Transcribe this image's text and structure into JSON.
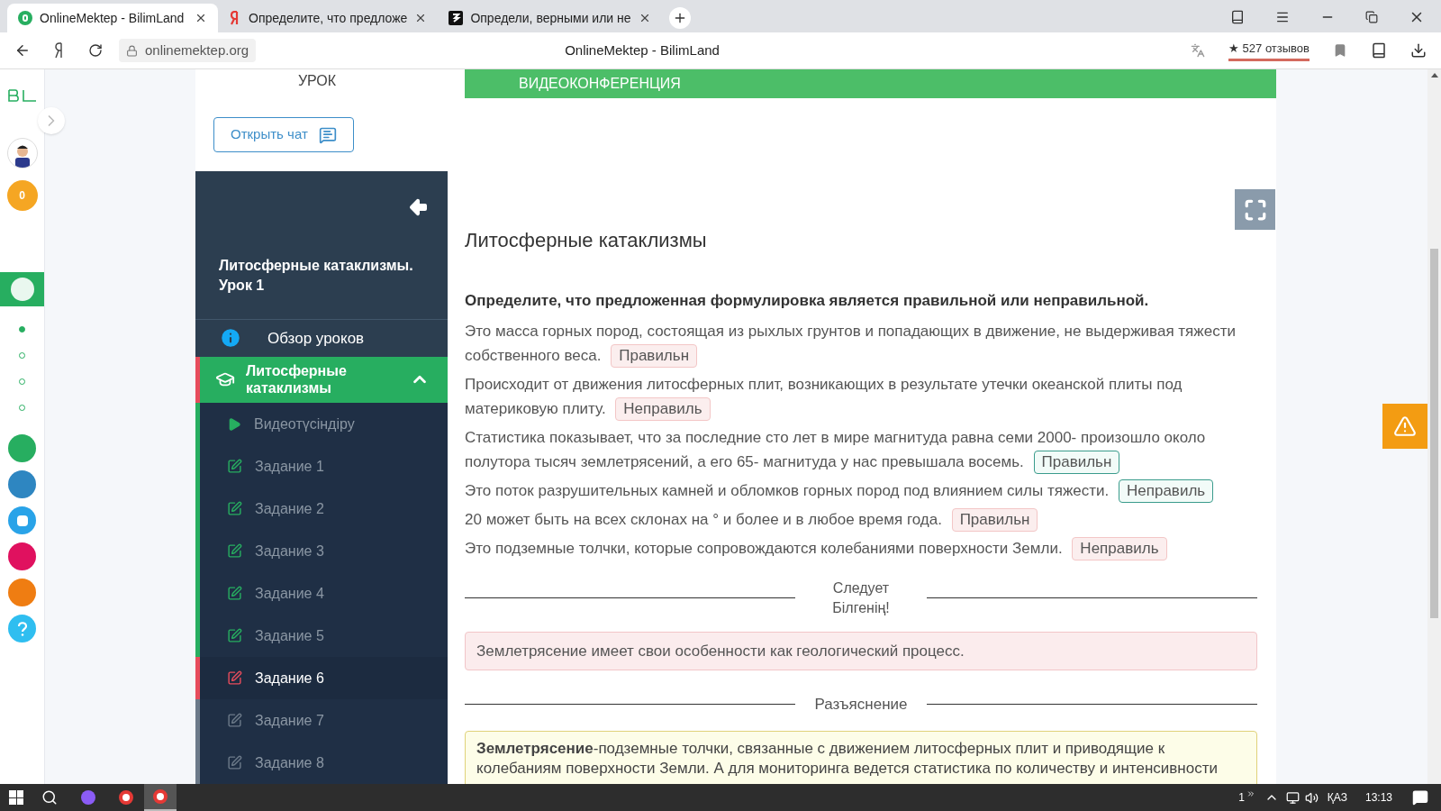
{
  "browser": {
    "tabs": [
      {
        "title": "OnlineMektep - BilimLand",
        "selected": true
      },
      {
        "title": "Определите, что предложе",
        "selected": false
      },
      {
        "title": "Определи, верными или не",
        "selected": false
      }
    ],
    "url": "onlinemektep.org",
    "page_title": "OnlineMektep - BilimLand",
    "reviews": "★ 527 отзывов"
  },
  "rail": {
    "badge": "0",
    "dots": [
      {
        "selected": true
      },
      {
        "selected": false
      },
      {
        "selected": false
      },
      {
        "selected": false
      }
    ]
  },
  "lesson_panel": {
    "tab_lesson": "УРОК",
    "chat_button": "Открыть чат",
    "title": "Литосферные катаклизмы. Урок 1",
    "overview": "Обзор уроков",
    "section": {
      "title": "Литосферные катаклизмы",
      "expanded": true
    },
    "items": [
      {
        "label": "Видеотүсіндіру",
        "kind": "video",
        "color": "#27ae60",
        "selected": false
      },
      {
        "label": "Задание 1",
        "kind": "task",
        "color": "#27ae60",
        "selected": false
      },
      {
        "label": "Задание 2",
        "kind": "task",
        "color": "#27ae60",
        "selected": false
      },
      {
        "label": "Задание 3",
        "kind": "task",
        "color": "#27ae60",
        "selected": false
      },
      {
        "label": "Задание 4",
        "kind": "task",
        "color": "#27ae60",
        "selected": false
      },
      {
        "label": "Задание 5",
        "kind": "task",
        "color": "#27ae60",
        "selected": false
      },
      {
        "label": "Задание 6",
        "kind": "task",
        "color": "#e74c5c",
        "selected": true
      },
      {
        "label": "Задание 7",
        "kind": "task",
        "color": "#6c7a89",
        "selected": false
      },
      {
        "label": "Задание 8",
        "kind": "task",
        "color": "#6c7a89",
        "selected": false
      }
    ]
  },
  "main": {
    "videoconference": "ВИДЕОКОНФЕРЕНЦИЯ",
    "heading": "Литосферные катаклизмы",
    "question": "Определите, что предложенная формулировка является правильной или неправильной.",
    "statements": [
      {
        "text": "Это масса горных пород, состоящая из рыхлых грунтов и попадающих в движение, не выдерживая тяжести собственного веса.",
        "answer": "Правильн",
        "correct": false
      },
      {
        "text": "Происходит от движения литосферных плит, возникающих в результате утечки океанской плиты под материковую плиту.",
        "answer": "Неправиль",
        "correct": false
      },
      {
        "text": "Статистика показывает, что за последние сто лет в мире магнитуда равна семи 2000- произошло около полутора тысяч землетрясений, а его 65- магнитуда у нас превышала восемь.",
        "answer": "Правильн",
        "correct": true
      },
      {
        "text": "Это поток разрушительных камней и обломков горных пород под влиянием силы тяжести.",
        "answer": "Неправиль",
        "correct": true
      },
      {
        "text": "20 может быть на всех склонах на ° и более и в любое время года.",
        "answer": "Правильн",
        "correct": false
      },
      {
        "text": "Это подземные толчки, которые сопровождаются колебаниями поверхности Земли.",
        "answer": "Неправиль",
        "correct": false
      }
    ],
    "hint_title": "Следует Білгенің!",
    "hint": "Землетрясение имеет свои особенности как геологический процесс.",
    "explanation_title": "Разъяснение",
    "explanation": "**Землетрясение**-подземные толчки, связанные с движением литосферных плит и приводящие к колебаниям поверхности Земли. А для мониторинга ведется статистика по количеству и интенсивности"
  },
  "taskbar": {
    "notifications": "1",
    "language": "ҚАЗ",
    "time": "13:13"
  }
}
